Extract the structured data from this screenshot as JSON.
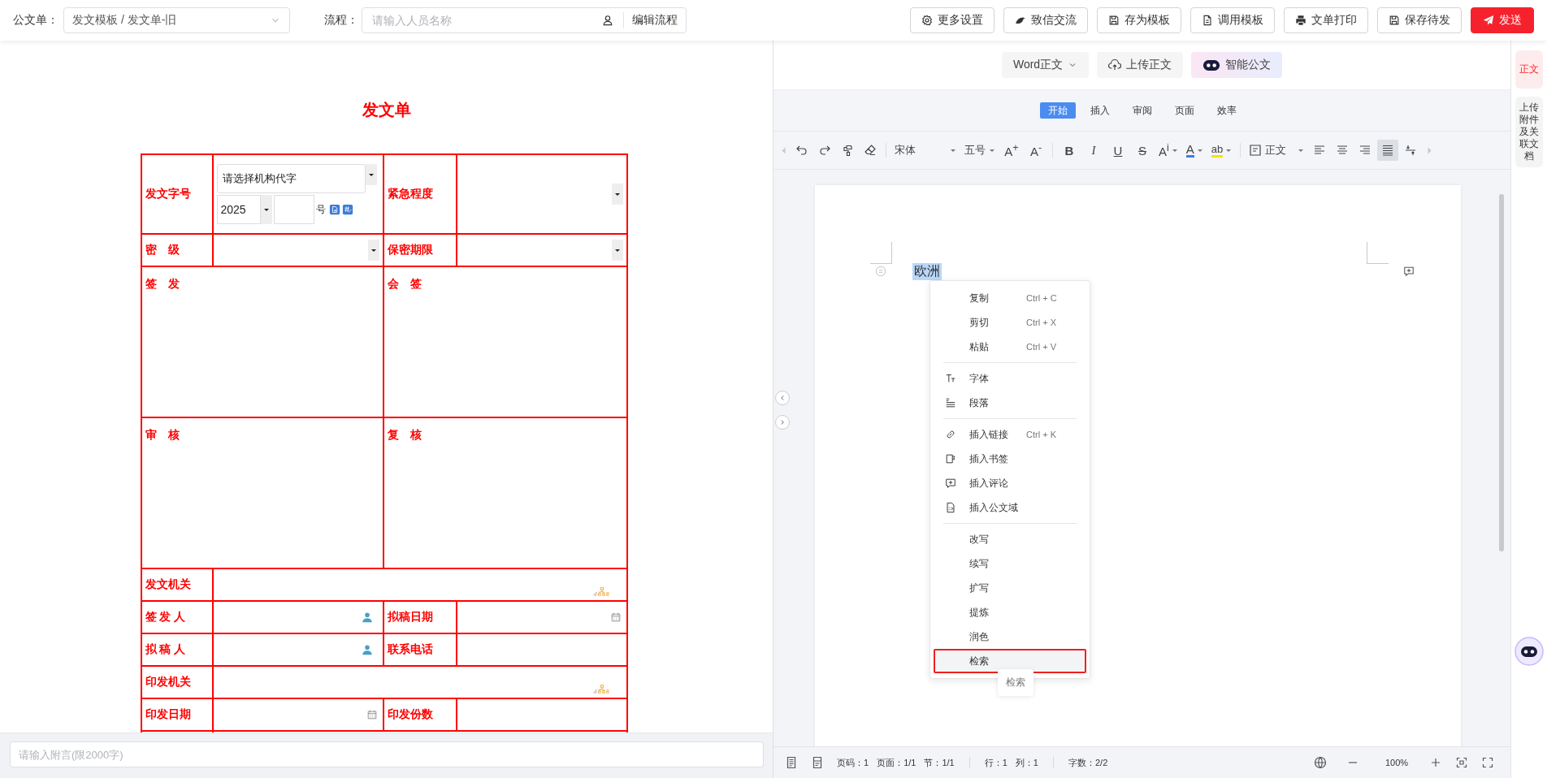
{
  "header": {
    "form_label": "公文单：",
    "form_template": "发文模板 / 发文单-旧",
    "flow_label": "流程：",
    "flow_placeholder": "请输入人员名称",
    "edit_flow": "编辑流程",
    "actions": [
      {
        "label": "更多设置",
        "kind": "settings"
      },
      {
        "label": "致信交流",
        "kind": "chat"
      },
      {
        "label": "存为模板",
        "kind": "save-template"
      },
      {
        "label": "调用模板",
        "kind": "use-template"
      },
      {
        "label": "文单打印",
        "kind": "print"
      },
      {
        "label": "保存待发",
        "kind": "save"
      },
      {
        "label": "发送",
        "kind": "send"
      }
    ]
  },
  "form": {
    "title": "发文单",
    "rows": [
      {
        "cells": [
          {
            "kind": "label",
            "text": "发文字号"
          },
          {
            "kind": "docnumber",
            "value": "请选择机构代字",
            "year": "2025",
            "suffix": "号"
          },
          {
            "kind": "label",
            "text": "紧急程度"
          },
          {
            "kind": "select"
          }
        ]
      },
      {
        "cells": [
          {
            "kind": "label",
            "text": "密　级"
          },
          {
            "kind": "select"
          },
          {
            "kind": "label",
            "text": "保密期限"
          },
          {
            "kind": "select"
          }
        ]
      },
      {
        "cells": [
          {
            "kind": "area",
            "text": "签　发",
            "colspan": 2
          },
          {
            "kind": "area",
            "text": "会　签",
            "colspan": 2
          }
        ]
      },
      {
        "cells": [
          {
            "kind": "area",
            "text": "审　核",
            "colspan": 2
          },
          {
            "kind": "area",
            "text": "复　核",
            "colspan": 2
          }
        ]
      },
      {
        "cells": [
          {
            "kind": "label",
            "text": "发文机关"
          },
          {
            "kind": "org",
            "colspan": 3
          }
        ]
      },
      {
        "cells": [
          {
            "kind": "label",
            "text": "签 发 人"
          },
          {
            "kind": "person"
          },
          {
            "kind": "label",
            "text": "拟稿日期"
          },
          {
            "kind": "date"
          }
        ]
      },
      {
        "cells": [
          {
            "kind": "label",
            "text": "拟 稿 人"
          },
          {
            "kind": "person"
          },
          {
            "kind": "label",
            "text": "联系电话"
          },
          {
            "kind": "empty"
          }
        ]
      },
      {
        "cells": [
          {
            "kind": "label",
            "text": "印发机关"
          },
          {
            "kind": "org",
            "colspan": 3
          }
        ]
      },
      {
        "cells": [
          {
            "kind": "label",
            "text": "印发日期"
          },
          {
            "kind": "date"
          },
          {
            "kind": "label",
            "text": "印发份数"
          },
          {
            "kind": "empty"
          }
        ]
      }
    ]
  },
  "remark": {
    "placeholder": "请输入附言(限2000字)"
  },
  "editor": {
    "doc_tabs": [
      {
        "label": "Word正文",
        "kind": "dropdown"
      },
      {
        "label": "上传正文",
        "kind": "upload"
      },
      {
        "label": "智能公文",
        "kind": "ai"
      }
    ],
    "ribbon_tabs": [
      {
        "label": "开始",
        "selected": true
      },
      {
        "label": "插入",
        "selected": false
      },
      {
        "label": "审阅",
        "selected": false
      },
      {
        "label": "页面",
        "selected": false
      },
      {
        "label": "效率",
        "selected": false
      }
    ],
    "toolbar": [
      {
        "kind": "nav-left"
      },
      {
        "kind": "undo"
      },
      {
        "kind": "redo"
      },
      {
        "kind": "painter"
      },
      {
        "kind": "eraser"
      },
      {
        "kind": "sep"
      },
      {
        "kind": "font",
        "text": "宋体"
      },
      {
        "kind": "size",
        "text": "五号"
      },
      {
        "kind": "glyph",
        "text": "A$^{+}$"
      },
      {
        "kind": "glyph",
        "text": "A$^{-}$"
      },
      {
        "kind": "sep"
      },
      {
        "kind": "bold",
        "text": "B"
      },
      {
        "kind": "italic",
        "text": "I"
      },
      {
        "kind": "underline",
        "text": "U"
      },
      {
        "kind": "strike",
        "text": "S"
      },
      {
        "kind": "glyph-menu",
        "text": "A$^{i}$"
      },
      {
        "kind": "font-color",
        "text": "A"
      },
      {
        "kind": "highlight",
        "text": "ab"
      },
      {
        "kind": "sep"
      },
      {
        "kind": "style",
        "text": "正文"
      },
      {
        "kind": "align-left",
        "selected": false
      },
      {
        "kind": "align-center",
        "selected": false
      },
      {
        "kind": "align-right",
        "selected": false
      },
      {
        "kind": "align-justify",
        "selected": true
      },
      {
        "kind": "spacing"
      },
      {
        "kind": "nav-right"
      }
    ],
    "document": {
      "text": "欧洲"
    },
    "context_menu": [
      {
        "kind": "item",
        "label": "复制",
        "shortcut": "Ctrl + C",
        "selected": false
      },
      {
        "kind": "item",
        "label": "剪切",
        "shortcut": "Ctrl + X",
        "selected": false
      },
      {
        "kind": "item",
        "label": "粘贴",
        "shortcut": "Ctrl + V",
        "selected": false
      },
      {
        "kind": "divider"
      },
      {
        "kind": "font",
        "label": "字体",
        "selected": false
      },
      {
        "kind": "paragraph",
        "label": "段落",
        "selected": false
      },
      {
        "kind": "divider"
      },
      {
        "kind": "link",
        "label": "插入链接",
        "shortcut": "Ctrl + K",
        "selected": false
      },
      {
        "kind": "bookmark",
        "label": "插入书签",
        "selected": false
      },
      {
        "kind": "comment",
        "label": "插入评论",
        "selected": false
      },
      {
        "kind": "field",
        "label": "插入公文域",
        "selected": false
      },
      {
        "kind": "divider"
      },
      {
        "kind": "item",
        "label": "改写",
        "selected": false
      },
      {
        "kind": "item",
        "label": "续写",
        "selected": false
      },
      {
        "kind": "item",
        "label": "扩写",
        "selected": false
      },
      {
        "kind": "item",
        "label": "提炼",
        "selected": false
      },
      {
        "kind": "item",
        "label": "润色",
        "selected": false
      },
      {
        "kind": "item",
        "label": "检索",
        "selected": true
      }
    ],
    "tooltip": "检索",
    "status": {
      "groups": [
        [
          "页码：1",
          "页面：1/1",
          "节：1/1"
        ],
        [
          "行：1",
          "列：1"
        ],
        [
          "字数：2/2"
        ]
      ],
      "zoom": "100%"
    }
  },
  "sidebar": [
    {
      "label": "正文",
      "selected": true
    },
    {
      "label": "上传附件及关联文档",
      "selected": false
    }
  ]
}
